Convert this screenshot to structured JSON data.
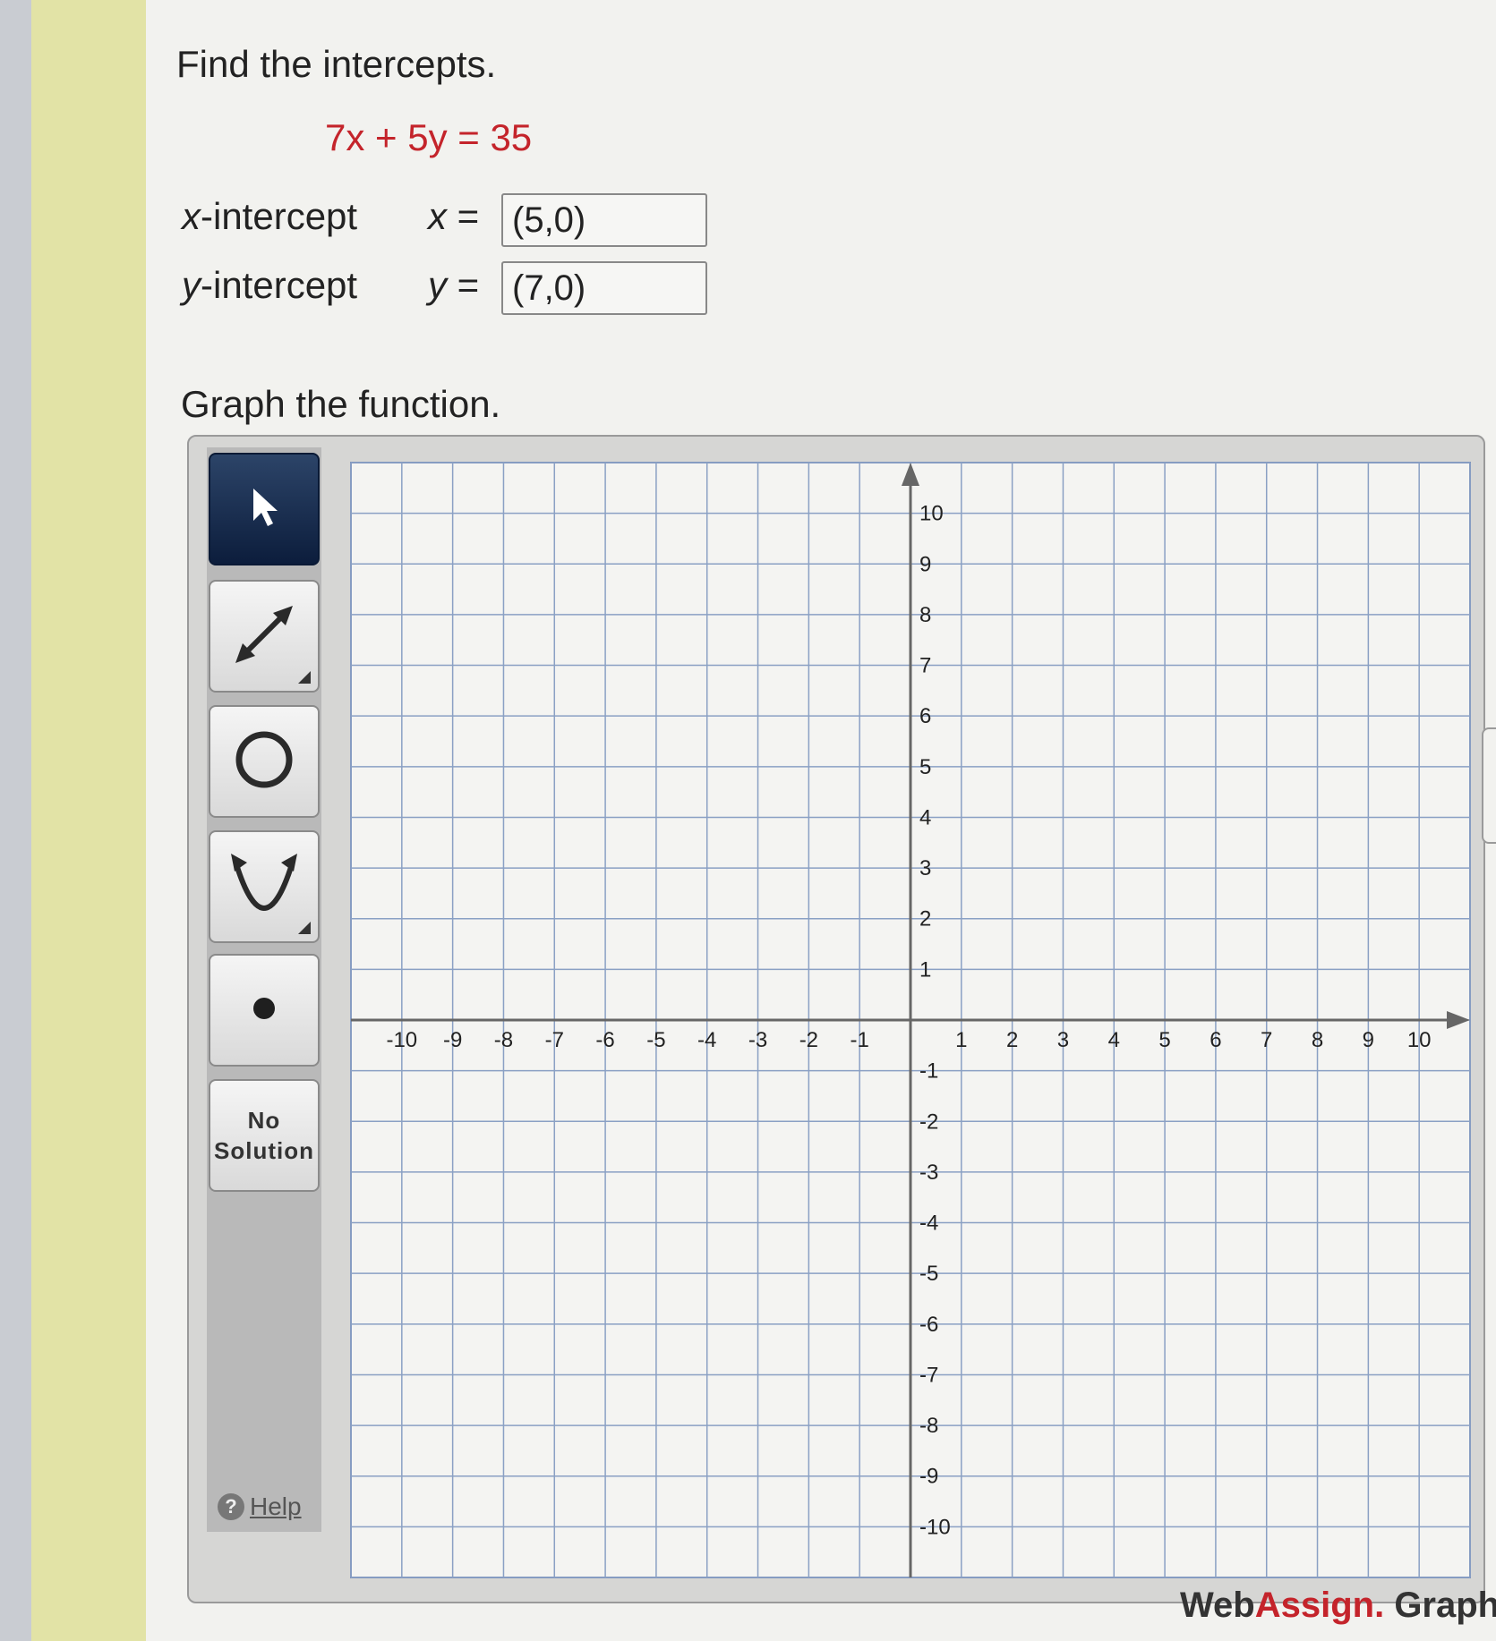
{
  "question": {
    "title": "Find the intercepts.",
    "equation": "7x + 5y = 35"
  },
  "x_intercept": {
    "label_var": "x",
    "label_text": "-intercept",
    "eq_var": "x",
    "eq_sign": "=",
    "value": "(5,0)"
  },
  "y_intercept": {
    "label_var": "y",
    "label_text": "-intercept",
    "eq_var": "y",
    "eq_sign": "=",
    "value": "(7,0)"
  },
  "graph": {
    "heading": "Graph the function.",
    "x_min": -10,
    "x_max": 10,
    "y_min": -10,
    "y_max": 10,
    "x_ticks": [
      "-10",
      "-9",
      "-8",
      "-7",
      "-6",
      "-5",
      "-4",
      "-3",
      "-2",
      "-1",
      "1",
      "2",
      "3",
      "4",
      "5",
      "6",
      "7",
      "8",
      "9",
      "10"
    ],
    "y_ticks": [
      "10",
      "9",
      "8",
      "7",
      "6",
      "5",
      "4",
      "3",
      "2",
      "1",
      "-1",
      "-2",
      "-3",
      "-4",
      "-5",
      "-6",
      "-7",
      "-8",
      "-9",
      "-10"
    ]
  },
  "toolbar": {
    "tools": [
      {
        "name": "pointer-tool",
        "icon": "arrow-pointer-icon"
      },
      {
        "name": "line-tool",
        "icon": "double-arrow-line-icon"
      },
      {
        "name": "circle-tool",
        "icon": "circle-icon"
      },
      {
        "name": "parabola-tool",
        "icon": "parabola-icon"
      },
      {
        "name": "point-tool",
        "icon": "point-icon"
      }
    ],
    "no_solution_line1": "No",
    "no_solution_line2": "Solution",
    "help_label": "Help"
  },
  "branding": {
    "web": "Web",
    "assign": "Assign.",
    "suffix": " Graphing"
  },
  "colors": {
    "accent_red": "#c4242b",
    "active_tool": "#0c1d3c",
    "grid_line": "#8aa0c4",
    "axis": "#666666"
  }
}
